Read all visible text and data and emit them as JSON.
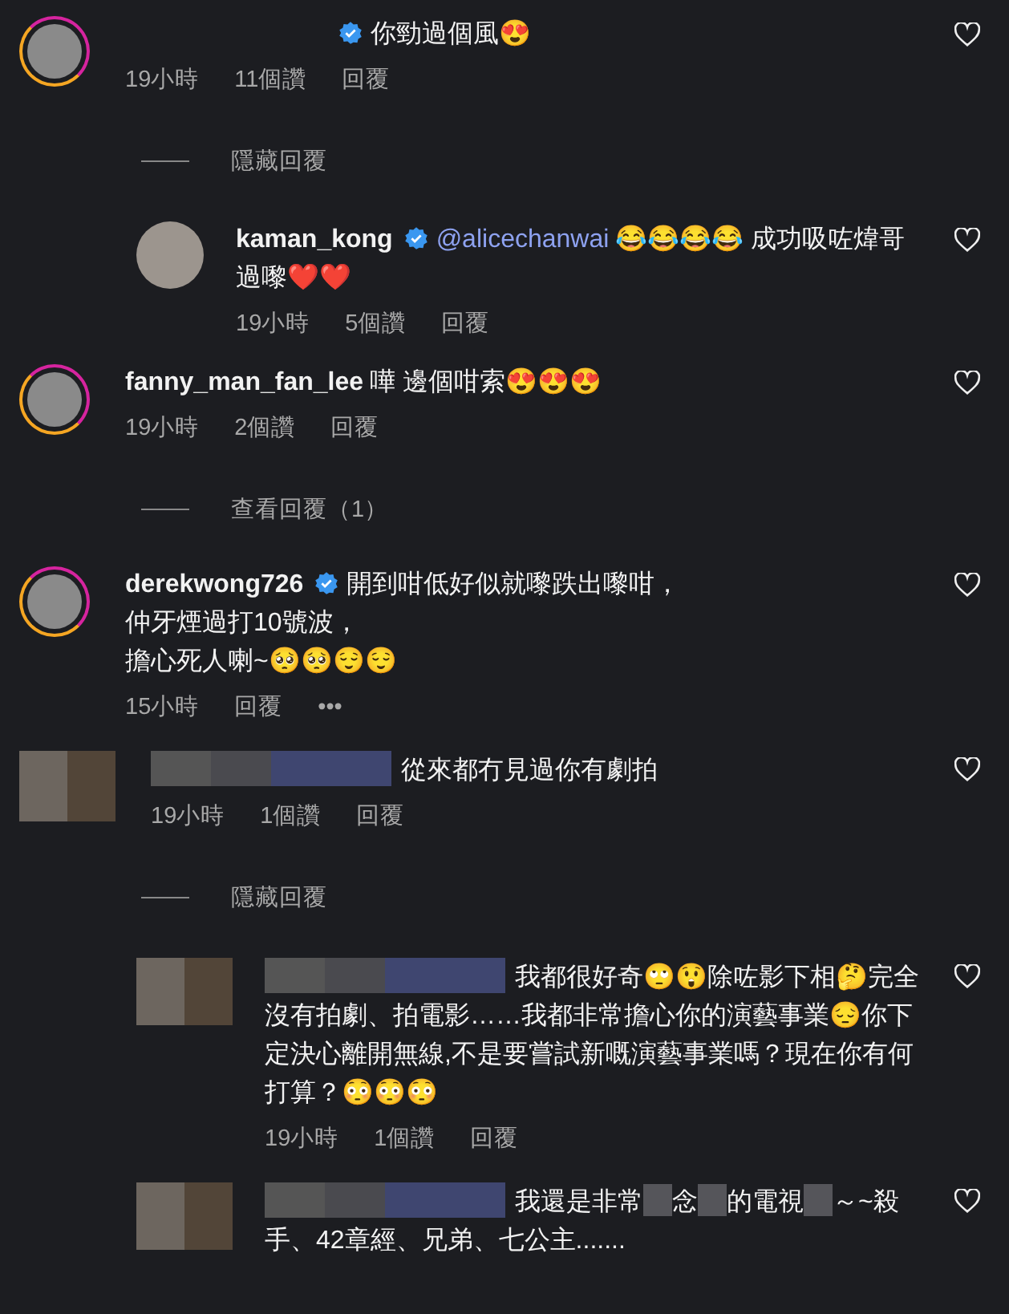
{
  "comments": [
    {
      "story_ring": true,
      "name_hidden": true,
      "redacted": false,
      "verified": true,
      "text": "你勁過個風😍",
      "time": "19小時",
      "likes": "11個讚",
      "reply_label": "回覆",
      "replies_toggle": "隱藏回覆",
      "replies": [
        {
          "story_ring": false,
          "redacted": false,
          "username": "kaman_kong",
          "verified": true,
          "mention": "@alicechanwai",
          "text": "😂😂😂😂 成功吸咗煒哥過嚟❤️❤️",
          "time": "19小時",
          "likes": "5個讚",
          "reply_label": "回覆"
        }
      ]
    },
    {
      "story_ring": true,
      "redacted": false,
      "username": "fanny_man_fan_lee",
      "verified": false,
      "text": "嘩 邊個咁索😍😍😍",
      "time": "19小時",
      "likes": "2個讚",
      "reply_label": "回覆",
      "replies_toggle": "查看回覆（1）"
    },
    {
      "story_ring": true,
      "redacted": false,
      "username": "derekwong726",
      "verified": true,
      "lines": [
        "開到咁低好似就嚟跌出嚟咁，",
        "仲牙煙過打10號波，",
        "擔心死人喇~🥺🥺😌😌"
      ],
      "time": "15小時",
      "reply_label": "回覆",
      "more": "•••"
    },
    {
      "redacted": true,
      "verified": false,
      "text": "從來都冇見過你有劇拍",
      "time": "19小時",
      "likes": "1個讚",
      "reply_label": "回覆",
      "replies_toggle": "隱藏回覆",
      "replies": [
        {
          "redacted": true,
          "verified": false,
          "text": "我都很好奇🙄😲除咗影下相🤔完全沒有拍劇、拍電影……我都非常擔心你的演藝事業😔你下定決心離開無線,不是要嘗試新嘅演藝事業嗎？現在你有何打算？😳😳😳",
          "time": "19小時",
          "likes": "1個讚",
          "reply_label": "回覆"
        },
        {
          "redacted": true,
          "verified": false,
          "text_segments": [
            "我還是非常",
            "念",
            "的電視",
            "～~殺手、42章經、兄弟、七公主......."
          ]
        }
      ]
    }
  ]
}
